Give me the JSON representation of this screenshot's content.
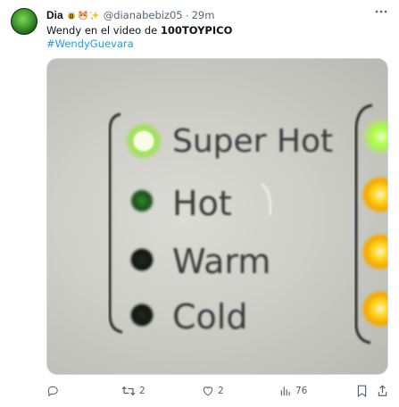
{
  "tweet": {
    "display_name": "Dia",
    "name_emojis": [
      "bee-emoji",
      "hamster-emoji",
      "sparkle-star-emoji"
    ],
    "handle": "@dianabebiz05",
    "separator": "·",
    "time": "29m",
    "text_prefix": "Wendy en el video de ",
    "text_bold": "100TOYPICO",
    "hashtag": "#WendyGuevara"
  },
  "media": {
    "labels": [
      "Super Hot",
      "Hot",
      "Warm",
      "Cold"
    ],
    "indicator_colors": {
      "super_hot": "#d8ff9a",
      "hot": "#1f6a1f",
      "warm": "#16321a",
      "cold": "#14201a",
      "right_leds": "#ffd21a"
    }
  },
  "actions": {
    "replies": "",
    "reposts": "2",
    "likes": "2",
    "views": "76"
  },
  "colors": {
    "text": "#0f1419",
    "muted": "#536471",
    "link": "#1d9bf0",
    "border": "#cfd9de"
  },
  "icons": [
    "more-icon",
    "reply-icon",
    "repost-icon",
    "like-icon",
    "views-icon",
    "bookmark-icon",
    "share-icon"
  ]
}
